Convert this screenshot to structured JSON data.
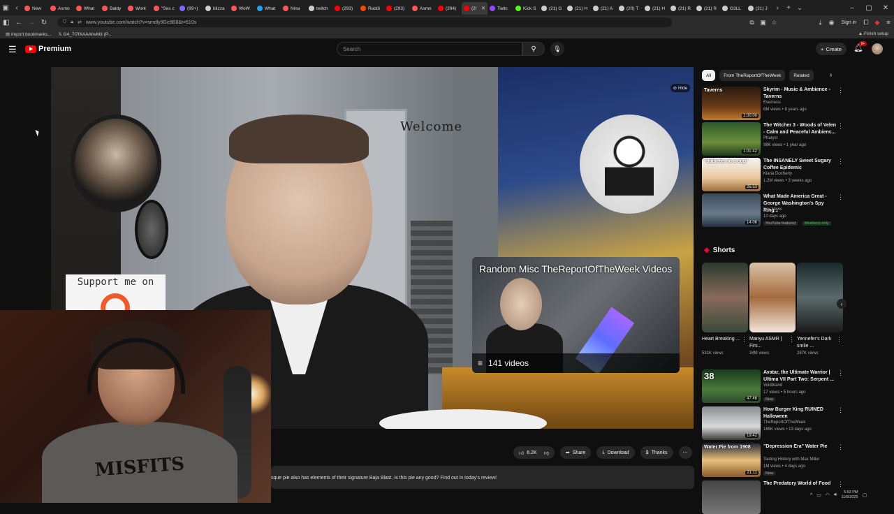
{
  "browser": {
    "tabs": [
      {
        "label": "New",
        "color": "#ff5555"
      },
      {
        "label": "Asmo",
        "color": "#ff5555"
      },
      {
        "label": "What",
        "color": "#ff5555"
      },
      {
        "label": "Baldy",
        "color": "#ff5555"
      },
      {
        "label": "Work",
        "color": "#ff5555"
      },
      {
        "label": "\"Sex c",
        "color": "#ff5555"
      },
      {
        "label": "(99+)",
        "color": "#7a6bff"
      },
      {
        "label": "blizza",
        "color": "#cccccc"
      },
      {
        "label": "WoW",
        "color": "#ff5555"
      },
      {
        "label": "What",
        "color": "#1da1f2"
      },
      {
        "label": "Nina",
        "color": "#ff5555"
      },
      {
        "label": "twitch",
        "color": "#cccccc"
      },
      {
        "label": "(293)",
        "color": "#ff0000"
      },
      {
        "label": "Reddi",
        "color": "#ff4500"
      },
      {
        "label": "(293)",
        "color": "#ff0000"
      },
      {
        "label": "Asmo",
        "color": "#ff5555"
      },
      {
        "label": "(294)",
        "color": "#ff0000"
      },
      {
        "label": "(2!",
        "color": "#ff0000",
        "active": true
      },
      {
        "label": "Twitc",
        "color": "#9146ff"
      },
      {
        "label": "Kick S",
        "color": "#53fc18"
      },
      {
        "label": "(21) G",
        "color": "#cccccc"
      },
      {
        "label": "(21) H",
        "color": "#cccccc"
      },
      {
        "label": "(21) A",
        "color": "#cccccc"
      },
      {
        "label": "(20) T",
        "color": "#cccccc"
      },
      {
        "label": "(21) H",
        "color": "#cccccc"
      },
      {
        "label": "(21) R",
        "color": "#cccccc"
      },
      {
        "label": "(21) R",
        "color": "#cccccc"
      },
      {
        "label": "G3LL",
        "color": "#cccccc"
      },
      {
        "label": "(21) J",
        "color": "#cccccc"
      }
    ],
    "url": "www.youtube.com/watch?v=smdly9Ge9B8&t=510s",
    "signin": "Sign in",
    "finish_setup": "Finish setup",
    "bookmarks": [
      "Import bookmarks...",
      "G4_7t7fXAAAhvM3 (P..."
    ]
  },
  "youtube": {
    "brand": "Premium",
    "search_placeholder": "Search",
    "create": "Create",
    "notif_count": "9+"
  },
  "video": {
    "hide_label": "Hide",
    "welcome_sign": "Welcome",
    "support_text": "Support me on",
    "playlist": {
      "title": "Random Misc TheReportOfTheWeek Videos",
      "count": "141 videos"
    },
    "actions": {
      "likes": "6.2K",
      "share": "Share",
      "download": "Download",
      "thanks": "Thanks"
    },
    "description": "sque pie also has elements of their signature Baja Blast. Is this pie any good? Find out in today's review!"
  },
  "sidebar": {
    "chips": [
      "All",
      "From TheReportOfTheWeek",
      "Related"
    ],
    "recs": [
      {
        "title": "Skyrim - Music & Ambience - Taverns",
        "channel": "Everness",
        "meta": "6M views • 8 years ago",
        "duration": "1:00:00",
        "overlay": "Taverns",
        "thumb": "linear-gradient(#2a1b10,#6b3a18 60%,#c07a2c)"
      },
      {
        "title": "The Witcher 3 - Woods of Velen - Calm and Peaceful Ambienc...",
        "channel": "Pharyst",
        "meta": "98K views • 1 year ago",
        "duration": "1:01:42",
        "overlay": "",
        "thumb": "linear-gradient(#2d5a2a,#6c8f3a 60%,#1f3a1d)"
      },
      {
        "title": "The INSANELY Sweet Sugary Coffee Epidemic",
        "channel": "Kiana Docherty",
        "meta": "1.2M views • 3 weeks ago",
        "duration": "26:53",
        "overlay": "\"diabetes in a cup\"",
        "thumb": "linear-gradient(#f4f4f4,#e8c79b 60%,#a06b3b)"
      },
      {
        "title": "What Made America Great - George Washington's Spy Ring...",
        "channel": "Fox News",
        "meta": "10 days ago",
        "duration": "14:06",
        "overlay": "",
        "badge": "YouTube featured",
        "badge2": "Members only",
        "thumb": "linear-gradient(#3a4a5a,#6a7a8a 60%,#22303c)"
      }
    ],
    "shorts_label": "Shorts",
    "shorts": [
      {
        "title": "Heart Breaking ...",
        "views": "531K views",
        "thumb": "linear-gradient(#2a3a30,#8a6a5a 50%,#3a4a3a)"
      },
      {
        "title": "Manyu ASMR | Firs...",
        "views": "34M views",
        "thumb": "linear-gradient(#d9c2a8,#a46a3c 50%,#f2e6da)"
      },
      {
        "title": "Yennefer's Dark smile ...",
        "views": "287K views",
        "thumb": "linear-gradient(#1a2a2a,#5a6a6a 50%,#1a1a1a)"
      }
    ],
    "recs2": [
      {
        "title": "Avatar, the Ultimate Warrior | Ultima VII Part Two: Serpent ...",
        "channel": "Voidbrand",
        "meta": "17 views • 5 hours ago",
        "duration": "47:46",
        "badge": "New",
        "overlay": "38",
        "thumb": "linear-gradient(#1a3a1a,#4a7a3a 60%,#2a4a2a)"
      },
      {
        "title": "How Burger King RUINED Halloween",
        "channel": "TheReportOfTheWeek",
        "meta": "185K views • 13 days ago",
        "duration": "19:42",
        "overlay": "",
        "thumb": "linear-gradient(#8a8f94,#d8d8d8 60%,#3a3a3a)"
      },
      {
        "title": "\"Depression Era\" Water Pie",
        "channel": "Tasting History with Max Miller",
        "meta": "1M views • 4 days ago",
        "duration": "21:11",
        "badge": "New",
        "overlay": "Water Pie from 1908",
        "thumb": "linear-gradient(#2a2a3a,#e8c07a 50%,#8a5a2a)"
      },
      {
        "title": "The Predatory World of Food",
        "channel": "",
        "meta": "",
        "duration": "",
        "overlay": "",
        "thumb": "linear-gradient(#444,#777)"
      }
    ]
  },
  "webcam": {
    "shirt_text": "MISFITS"
  },
  "taskbar": {
    "time": "5:53 PM",
    "date": "11/8/2025"
  }
}
